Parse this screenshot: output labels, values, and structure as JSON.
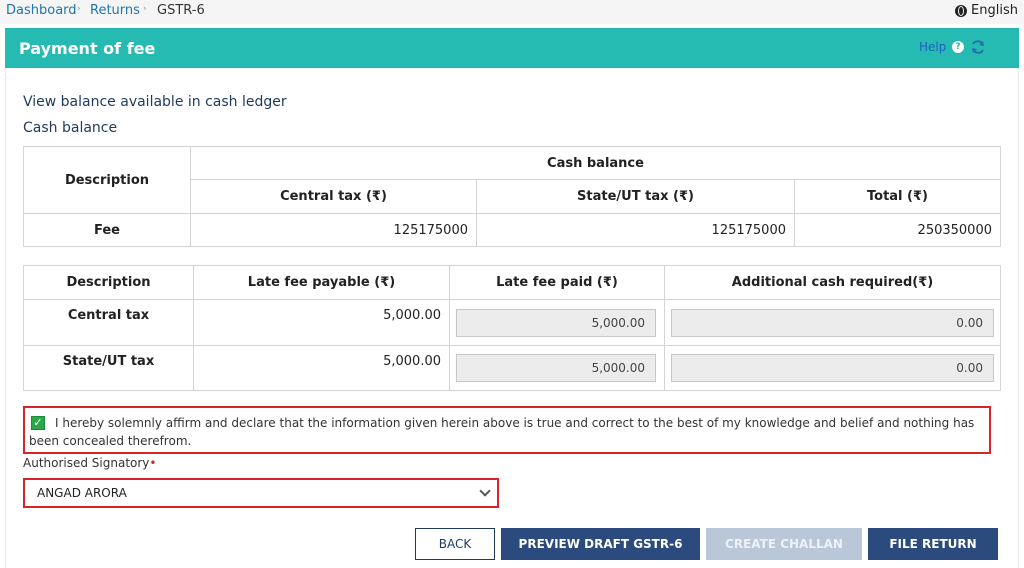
{
  "breadcrumb": {
    "items": [
      "Dashboard",
      "Returns"
    ],
    "current": "GSTR-6",
    "separator": "›"
  },
  "language": {
    "label": "English"
  },
  "header": {
    "title": "Payment of fee",
    "help_label": "Help",
    "help_icon_glyph": "?"
  },
  "cash_ledger": {
    "view_title": "View balance available in cash ledger",
    "section_title": "Cash balance",
    "table": {
      "group_header": "Cash balance",
      "columns": [
        "Description",
        "Central tax (₹)",
        "State/UT tax (₹)",
        "Total (₹)"
      ],
      "rows": [
        {
          "description": "Fee",
          "central": "125175000",
          "state": "125175000",
          "total": "250350000"
        }
      ]
    }
  },
  "late_fee": {
    "columns": [
      "Description",
      "Late fee payable (₹)",
      "Late fee paid (₹)",
      "Additional cash required(₹)"
    ],
    "rows": [
      {
        "description": "Central tax",
        "payable": "5,000.00",
        "paid": "5,000.00",
        "additional": "0.00"
      },
      {
        "description": "State/UT tax",
        "payable": "5,000.00",
        "paid": "5,000.00",
        "additional": "0.00"
      }
    ]
  },
  "declaration": {
    "checked": true,
    "check_glyph": "✓",
    "text": "I hereby solemnly affirm and declare that the information given herein above is true and correct to the best of my knowledge and belief and nothing has been concealed therefrom."
  },
  "signatory": {
    "label": "Authorised Signatory",
    "required_mark": "•",
    "value": "ANGAD ARORA"
  },
  "buttons": {
    "back": "BACK",
    "preview": "PREVIEW DRAFT GSTR-6",
    "create_challan": "CREATE CHALLAN",
    "file_return": "FILE RETURN"
  },
  "colors": {
    "header_teal": "#26bbb2",
    "primary_button": "#2b4a7e",
    "disabled_button": "#b9c7d8",
    "highlight_red": "#d9232d",
    "check_green": "#2aa84a"
  }
}
